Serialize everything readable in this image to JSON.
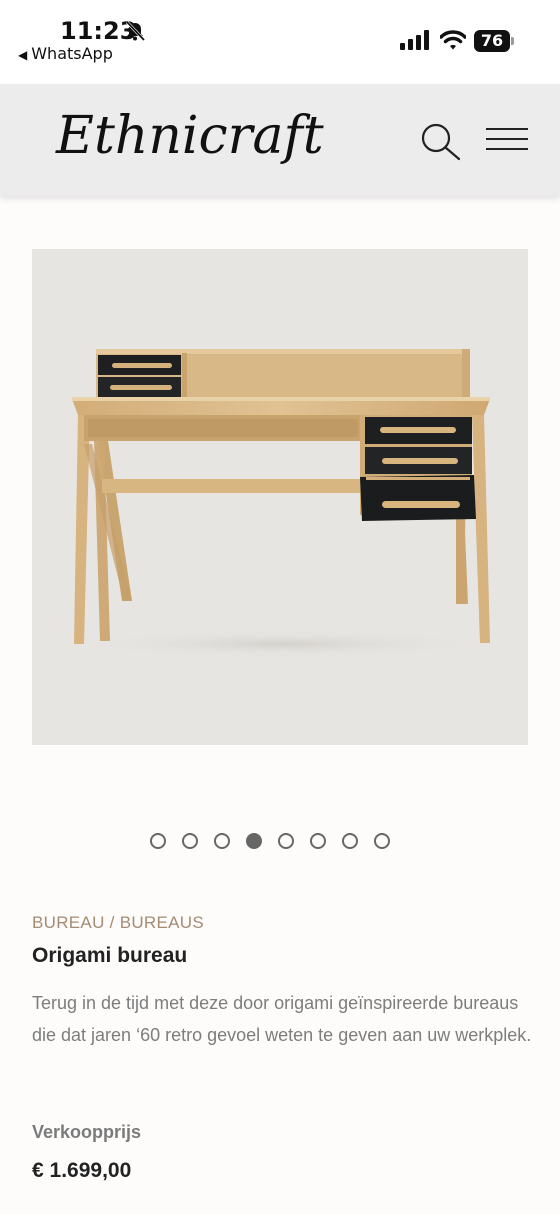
{
  "status_bar": {
    "time": "11:23",
    "back_app": "WhatsApp",
    "battery": "76"
  },
  "header": {
    "logo": "Ethnicraft",
    "search_icon": "search-icon",
    "menu_icon": "hamburger-menu-icon"
  },
  "gallery": {
    "dot_count": 8,
    "active_index": 3
  },
  "product": {
    "breadcrumb": "BUREAU / BUREAUS",
    "title": "Origami bureau",
    "description": "Terug in de tijd met deze door origami geïnspireerde bureaus die dat jaren ‘60 retro gevoel weten te geven aan uw werkplek.",
    "price_label": "Verkoopprijs",
    "price": "€ 1.699,00"
  },
  "colors": {
    "header_bg": "#ececec",
    "breadcrumb": "#a38c73",
    "image_bg": "#e7e5e2",
    "oak": "#d9b888",
    "drawer": "#1e1f21"
  }
}
